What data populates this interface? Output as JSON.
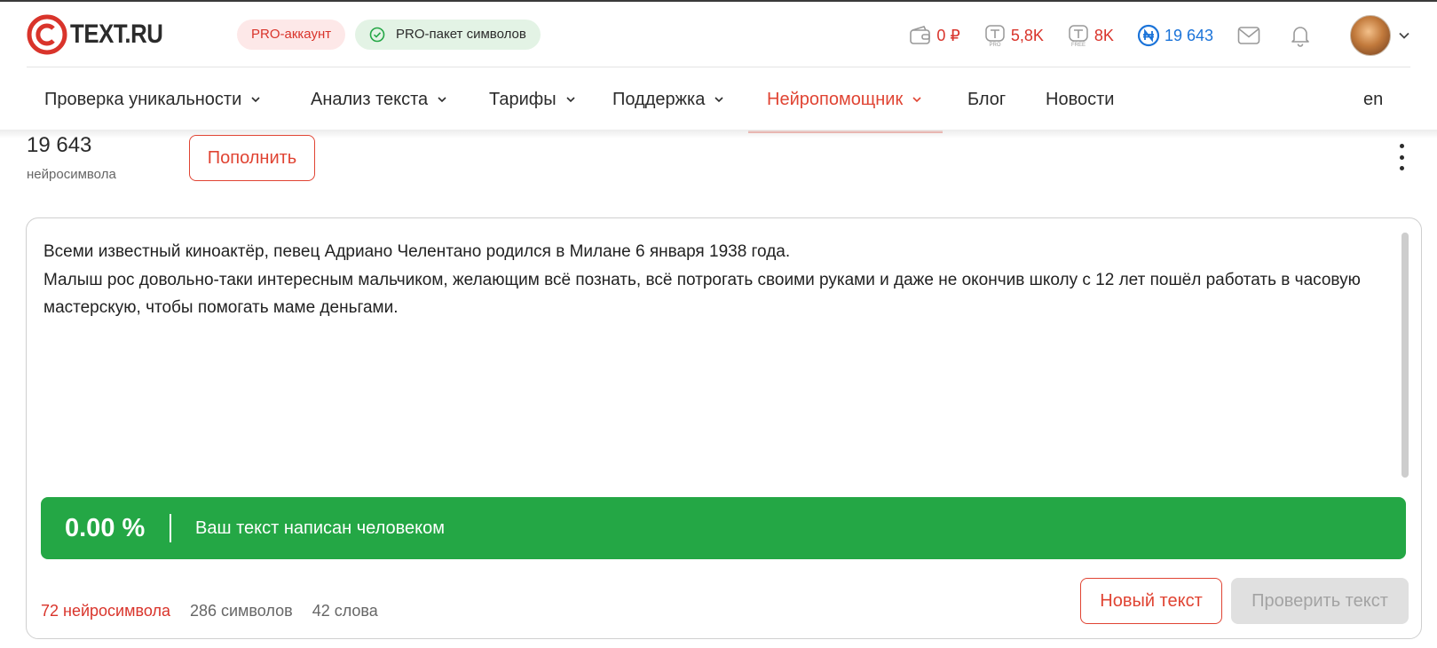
{
  "header": {
    "logo_text": "TEXT.RU",
    "pro_account_badge": "PRO-аккаунт",
    "pro_package_badge": "PRO-пакет символов",
    "stats": {
      "wallet": "0 ₽",
      "pro_symbols": "5,8K",
      "free_symbols": "8K",
      "neuro_symbols": "19 643"
    },
    "icons": [
      "wallet-icon",
      "pro-symbols-icon",
      "free-symbols-icon",
      "neuro-symbols-icon",
      "mail-icon",
      "bell-icon",
      "avatar"
    ]
  },
  "nav": {
    "items": [
      {
        "label": "Проверка уникальности",
        "has_dropdown": true
      },
      {
        "label": "Анализ текста",
        "has_dropdown": true
      },
      {
        "label": "Тарифы",
        "has_dropdown": true
      },
      {
        "label": "Поддержка",
        "has_dropdown": true
      },
      {
        "label": "Нейропомощник",
        "has_dropdown": true,
        "active": true
      },
      {
        "label": "Блог",
        "has_dropdown": false
      },
      {
        "label": "Новости",
        "has_dropdown": false
      }
    ],
    "lang": "en"
  },
  "balance": {
    "value": "19 643",
    "label": "нейросимвола",
    "topup_label": "Пополнить"
  },
  "editor": {
    "text": "Всеми известный киноактёр, певец Адриано Челентано родился в Милане 6 января 1938 года.\nМалыш рос довольно-таки интересным мальчиком, желающим всё познать, всё потрогать своими руками и даже не окончив школу с 12 лет пошёл работать в часовую мастерскую, чтобы помогать маме деньгами."
  },
  "result": {
    "percent": "0.00 %",
    "message": "Ваш текст написан человеком"
  },
  "counters": {
    "neuro": "72 нейросимвола",
    "chars": "286 символов",
    "words": "42 слова"
  },
  "buttons": {
    "new_text": "Новый текст",
    "check_text": "Проверить текст"
  },
  "colors": {
    "brand_red": "#e04433",
    "success_green": "#24a745",
    "link_blue": "#1a73d9"
  }
}
